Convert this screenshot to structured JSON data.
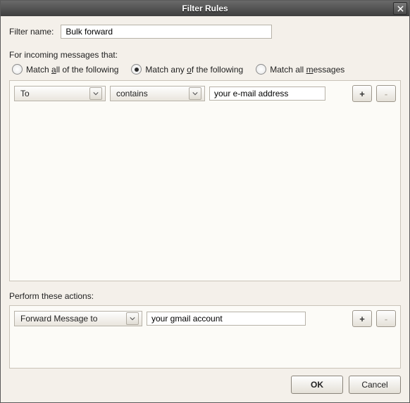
{
  "window": {
    "title": "Filter Rules"
  },
  "labels": {
    "filterName": "Filter name:",
    "incoming": "For incoming messages that:",
    "performActions": "Perform these actions:"
  },
  "filter": {
    "name": "Bulk forward"
  },
  "matchMode": {
    "selected": "any",
    "options": {
      "all": {
        "pre": "Match ",
        "u": "a",
        "post": "ll of the following"
      },
      "any": {
        "pre": "Match any ",
        "u": "o",
        "post": "f the following"
      },
      "every": {
        "pre": "Match all ",
        "u": "m",
        "post": "essages"
      }
    }
  },
  "conditions": [
    {
      "field": "To",
      "op": "contains",
      "value": "your e-mail address"
    }
  ],
  "actions": [
    {
      "type": "Forward Message to",
      "value": "your gmail account"
    }
  ],
  "buttons": {
    "ok": "OK",
    "cancel": "Cancel",
    "add": "+",
    "remove": "-"
  }
}
